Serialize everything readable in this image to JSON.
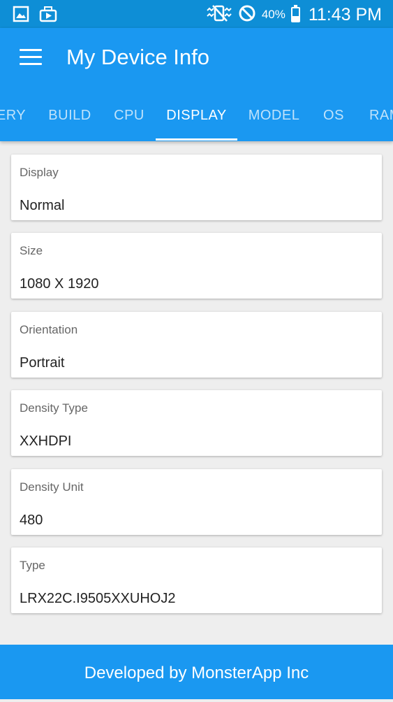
{
  "status_bar": {
    "battery_percent": "40%",
    "battery_level": 0.4,
    "time": "11:43 PM",
    "icons": [
      "gallery-icon",
      "media-icon",
      "vibrate-mute-icon",
      "block-icon",
      "battery-icon"
    ]
  },
  "app_bar": {
    "title": "My Device Info",
    "menu_icon": "hamburger-menu-icon"
  },
  "tabs": [
    {
      "label": "ERY"
    },
    {
      "label": "BUILD"
    },
    {
      "label": "CPU"
    },
    {
      "label": "DISPLAY",
      "active": true
    },
    {
      "label": "MODEL"
    },
    {
      "label": "OS"
    },
    {
      "label": "RAM"
    }
  ],
  "cards": [
    {
      "label": "Display",
      "value": "Normal"
    },
    {
      "label": "Size",
      "value": "1080 X 1920"
    },
    {
      "label": "Orientation",
      "value": "Portrait"
    },
    {
      "label": "Density Type",
      "value": "XXHDPI"
    },
    {
      "label": "Density Unit",
      "value": "480"
    },
    {
      "label": "Type",
      "value": "LRX22C.I9505XXUHOJ2"
    }
  ],
  "footer": {
    "text": "Developed by MonsterApp Inc"
  },
  "colors": {
    "status_bar": "#0e8ed6",
    "primary": "#1a98f1",
    "background": "#eeeeee"
  }
}
